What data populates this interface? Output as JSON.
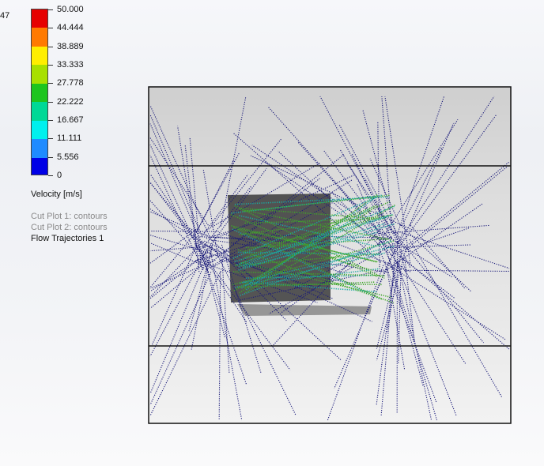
{
  "top_left_value": "47",
  "colorbar": {
    "colors": [
      "#e60000",
      "#ff7a00",
      "#ffee00",
      "#a8e000",
      "#1ec51e",
      "#00d896",
      "#00f0ee",
      "#1f8bff",
      "#0000e6"
    ],
    "tick_labels": [
      "50.000",
      "44.444",
      "38.889",
      "33.333",
      "27.778",
      "22.222",
      "16.667",
      "11.111",
      "5.556",
      "0"
    ]
  },
  "legend_title": "Velocity [m/s]",
  "legend_items": [
    {
      "label": "Cut Plot 1: contours",
      "active": false
    },
    {
      "label": "Cut Plot 2: contours",
      "active": false
    },
    {
      "label": "Flow Trajectories 1",
      "active": true
    }
  ],
  "colors": {
    "trajectory_low": "#1a1a7a",
    "trajectory_mid": "#1aa8a0",
    "trajectory_high": "#3fa62a",
    "box_border": "#111111"
  }
}
